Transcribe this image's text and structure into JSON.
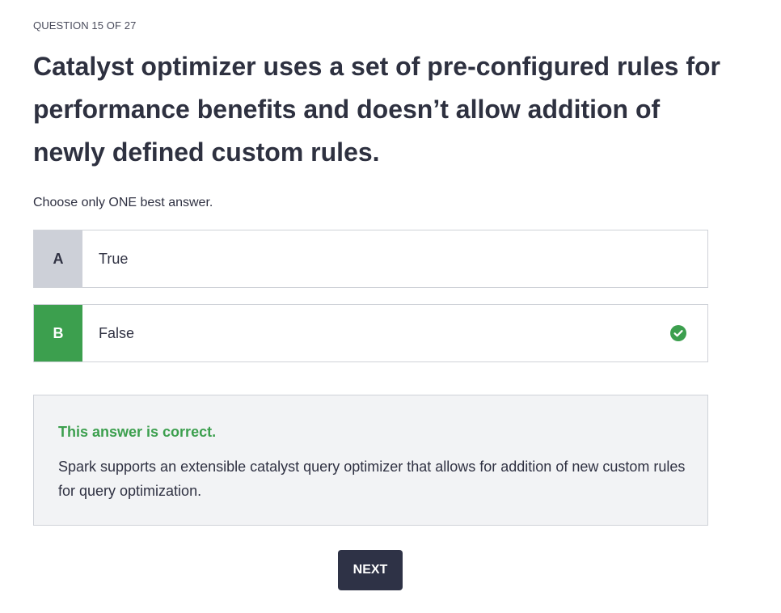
{
  "quiz": {
    "counter": "QUESTION 15 OF 27",
    "question": "Catalyst optimizer uses a set of pre-configured rules for performance benefits and doesn’t allow addition of newly defined custom rules.",
    "instruction": "Choose only ONE best answer.",
    "options": [
      {
        "letter": "A",
        "text": "True",
        "state": "unselected"
      },
      {
        "letter": "B",
        "text": "False",
        "state": "correct",
        "icon": "check-circle-icon"
      }
    ],
    "feedback": {
      "title": "This answer is correct.",
      "explanation": "Spark supports an extensible catalyst query optimizer that allows for addition of new custom rules for query optimization."
    },
    "next_label": "NEXT"
  },
  "colors": {
    "correct": "#3c9f4e",
    "neutral_letter_bg": "#cdd0d8",
    "button_bg": "#2e3246",
    "feedback_bg": "#f2f3f5"
  }
}
